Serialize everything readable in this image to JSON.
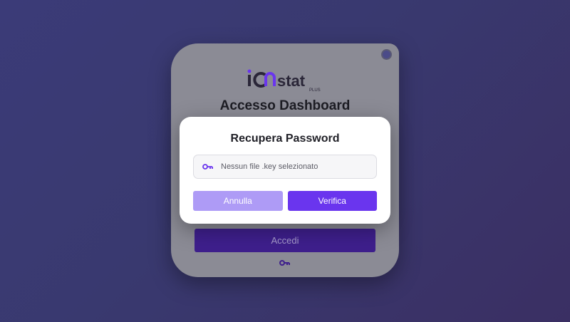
{
  "login": {
    "brand": {
      "name_prefix": "i",
      "name_suffix": "stat",
      "tier": "PLUS"
    },
    "title": "Accesso Dashboard",
    "submit_label": "Accedi"
  },
  "modal": {
    "title": "Recupera Password",
    "file_status": "Nessun file .key selezionato",
    "cancel_label": "Annulla",
    "verify_label": "Verifica"
  },
  "colors": {
    "accent": "#6a35ee",
    "accent_light": "#ae9bf6",
    "brand_dark": "#3e1f8c"
  },
  "icons": [
    "theme-toggle-icon",
    "key-icon"
  ]
}
